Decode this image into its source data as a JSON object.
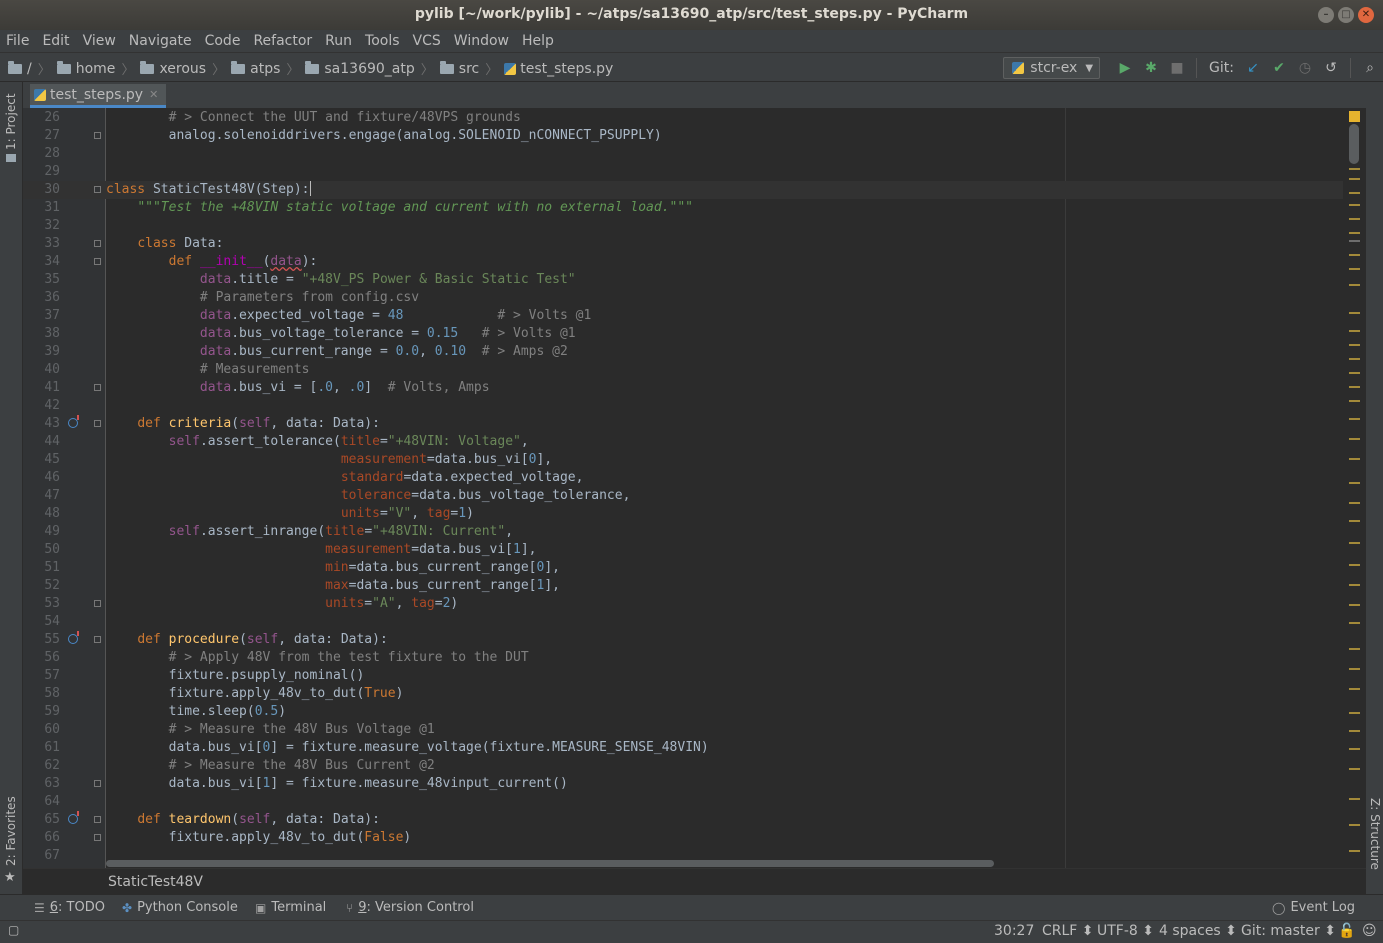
{
  "window": {
    "title": "pylib [~/work/pylib] - ~/atps/sa13690_atp/src/test_steps.py - PyCharm"
  },
  "menu": [
    "File",
    "Edit",
    "View",
    "Navigate",
    "Code",
    "Refactor",
    "Run",
    "Tools",
    "VCS",
    "Window",
    "Help"
  ],
  "breadcrumbs": [
    "/",
    "home",
    "xerous",
    "atps",
    "sa13690_atp",
    "src",
    "test_steps.py"
  ],
  "run_config": "stcr-ex",
  "git_label": "Git:",
  "left_tools": {
    "project": "1: Project",
    "favorites": "2: Favorites"
  },
  "right_tools": {
    "structure": "Z: Structure"
  },
  "tab": {
    "name": "test_steps.py"
  },
  "code_lines": [
    {
      "n": "26",
      "html": "        <span class=\"cmt\"># &gt; Connect the UUT and fixture/48VPS grounds</span>"
    },
    {
      "n": "27",
      "html": "        analog.solenoiddrivers.engage(analog.SOLENOID_nCONNECT_PSUPPLY)"
    },
    {
      "n": "28",
      "html": ""
    },
    {
      "n": "29",
      "html": ""
    },
    {
      "n": "30",
      "html": "<span class=\"kw\">class</span> StaticTest48V(Step):<span class=\"caret\"></span>"
    },
    {
      "n": "31",
      "html": "    <span class=\"doc\">\"\"\"Test the +48VIN static voltage and current with no external load.\"\"\"</span>"
    },
    {
      "n": "32",
      "html": ""
    },
    {
      "n": "33",
      "html": "    <span class=\"kw\">class</span> Data:"
    },
    {
      "n": "34",
      "html": "        <span class=\"kw\">def</span> <span class=\"magic\">__init__</span>(<span class=\"self warn\">data</span>):"
    },
    {
      "n": "35",
      "html": "            <span class=\"self\">data</span>.title = <span class=\"str\">\"+48V_PS Power &amp; Basic Static Test\"</span>"
    },
    {
      "n": "36",
      "html": "            <span class=\"cmt\"># Parameters from config.csv</span>"
    },
    {
      "n": "37",
      "html": "            <span class=\"self\">data</span>.expected_voltage = <span class=\"num\">48</span>            <span class=\"cmt\"># &gt; Volts @1</span>"
    },
    {
      "n": "38",
      "html": "            <span class=\"self\">data</span>.bus_voltage_tolerance = <span class=\"num\">0.15</span>   <span class=\"cmt\"># &gt; Volts @1</span>"
    },
    {
      "n": "39",
      "html": "            <span class=\"self\">data</span>.bus_current_range = <span class=\"num\">0.0</span>, <span class=\"num\">0.10</span>  <span class=\"cmt\"># &gt; Amps @2</span>"
    },
    {
      "n": "40",
      "html": "            <span class=\"cmt\"># Measurements</span>"
    },
    {
      "n": "41",
      "html": "            <span class=\"self\">data</span>.bus_vi = [<span class=\"num\">.0</span>, <span class=\"num\">.0</span>]  <span class=\"cmt\"># Volts, Amps</span>"
    },
    {
      "n": "42",
      "html": ""
    },
    {
      "n": "43",
      "html": "    <span class=\"kw\">def</span> <span class=\"fn\">criteria</span>(<span class=\"self\">self</span>, data: Data):"
    },
    {
      "n": "44",
      "html": "        <span class=\"self\">self</span>.assert_tolerance(<span class=\"kwarg\">title</span>=<span class=\"str\">\"+48VIN: Voltage\"</span>,"
    },
    {
      "n": "45",
      "html": "                              <span class=\"kwarg\">measurement</span>=data.bus_vi[<span class=\"num\">0</span>],"
    },
    {
      "n": "46",
      "html": "                              <span class=\"kwarg\">standard</span>=data.expected_voltage,"
    },
    {
      "n": "47",
      "html": "                              <span class=\"kwarg\">tolerance</span>=data.bus_voltage_tolerance,"
    },
    {
      "n": "48",
      "html": "                              <span class=\"kwarg\">units</span>=<span class=\"str\">\"V\"</span>, <span class=\"kwarg\">tag</span>=<span class=\"num\">1</span>)"
    },
    {
      "n": "49",
      "html": "        <span class=\"self\">self</span>.assert_inrange(<span class=\"kwarg\">title</span>=<span class=\"str\">\"+48VIN: Current\"</span>,"
    },
    {
      "n": "50",
      "html": "                            <span class=\"kwarg\">measurement</span>=data.bus_vi[<span class=\"num\">1</span>],"
    },
    {
      "n": "51",
      "html": "                            <span class=\"kwarg\">min</span>=data.bus_current_range[<span class=\"num\">0</span>],"
    },
    {
      "n": "52",
      "html": "                            <span class=\"kwarg\">max</span>=data.bus_current_range[<span class=\"num\">1</span>],"
    },
    {
      "n": "53",
      "html": "                            <span class=\"kwarg\">units</span>=<span class=\"str\">\"A\"</span>, <span class=\"kwarg\">tag</span>=<span class=\"num\">2</span>)"
    },
    {
      "n": "54",
      "html": ""
    },
    {
      "n": "55",
      "html": "    <span class=\"kw\">def</span> <span class=\"fn\">procedure</span>(<span class=\"self\">self</span>, data: Data):"
    },
    {
      "n": "56",
      "html": "        <span class=\"cmt\"># &gt; Apply 48V from the test fixture to the DUT</span>"
    },
    {
      "n": "57",
      "html": "        fixture.psupply_nominal()"
    },
    {
      "n": "58",
      "html": "        fixture.apply_48v_to_dut(<span class=\"kw\">True</span>)"
    },
    {
      "n": "59",
      "html": "        time.sleep(<span class=\"num\">0.5</span>)"
    },
    {
      "n": "60",
      "html": "        <span class=\"cmt\"># &gt; Measure the 48V Bus Voltage @1</span>"
    },
    {
      "n": "61",
      "html": "        data.bus_vi[<span class=\"num\">0</span>] = fixture.measure_voltage(fixture.MEASURE_SENSE_48VIN)"
    },
    {
      "n": "62",
      "html": "        <span class=\"cmt\"># &gt; Measure the 48V Bus Current @2</span>"
    },
    {
      "n": "63",
      "html": "        data.bus_vi[<span class=\"num\">1</span>] = fixture.measure_48vinput_current()"
    },
    {
      "n": "64",
      "html": ""
    },
    {
      "n": "65",
      "html": "    <span class=\"kw\">def</span> <span class=\"fn\">teardown</span>(<span class=\"self\">self</span>, data: Data):"
    },
    {
      "n": "66",
      "html": "        fixture.apply_48v_to_dut(<span class=\"kw\">False</span>)"
    },
    {
      "n": "67",
      "html": ""
    }
  ],
  "editor_breadcrumb": "StaticTest48V",
  "bottom_tools": [
    {
      "num": "6",
      "label": ": TODO"
    },
    {
      "num": "",
      "label": "Python Console"
    },
    {
      "num": "",
      "label": "Terminal"
    },
    {
      "num": "9",
      "label": ": Version Control"
    }
  ],
  "event_log": "Event Log",
  "status": {
    "position": "30:27",
    "line_sep": "CRLF",
    "encoding": "UTF-8",
    "indent": "4 spaces",
    "git": "Git: master"
  }
}
